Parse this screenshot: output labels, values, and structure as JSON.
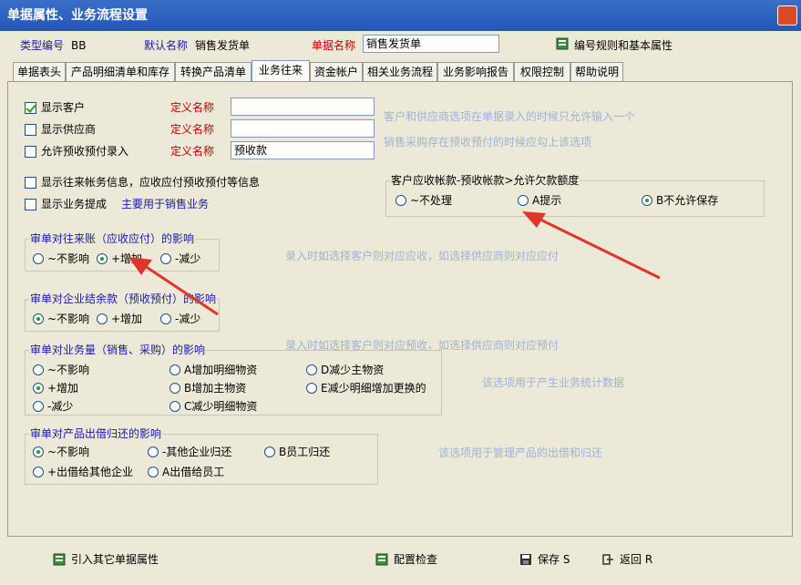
{
  "window": {
    "title": "单据属性、业务流程设置"
  },
  "header": {
    "type_code_label": "类型编号",
    "type_code_value": "BB",
    "default_name_label": "默认名称",
    "default_name_value": "销售发货单",
    "doc_name_label": "单据名称",
    "doc_name_value": "销售发货单",
    "numbering_button": "编号规则和基本属性"
  },
  "tabs": [
    "单据表头",
    "产品明细清单和库存",
    "转换产品清单",
    "业务往来",
    "资金帐户",
    "相关业务流程",
    "业务影响报告",
    "权限控制",
    "帮助说明"
  ],
  "active_tab": "业务往来",
  "options": {
    "show_customer": "显示客户",
    "show_supplier": "显示供应商",
    "allow_prepay": "允许预收预付录入",
    "define_name_label": "定义名称",
    "prepay_name_value": "预收款",
    "hint_customer": "客户和供应商选项在单据录入的时候只允许输入一个",
    "hint_prepay": "销售采购存在预收预付的时候应勾上该选项",
    "show_account_info": "显示往来帐务信息，应收应付预收预付等信息",
    "show_commission": "显示业务提成",
    "commission_note": "主要用于销售业务"
  },
  "credit_group": {
    "title": "客户应收帐款-预收帐款>允许欠款额度",
    "options": [
      "~不处理",
      "A提示",
      "B不允许保存"
    ],
    "selected": 2
  },
  "ar_group": {
    "title": "审单对往来账（应收应付）的影响",
    "options": [
      "~不影响",
      "+增加",
      "-减少"
    ],
    "selected": 1,
    "hint": "录入时如选择客户则对应应收，如选择供应商则对应应付"
  },
  "balance_group": {
    "title": "审单对企业结余款（预收预付）的影响",
    "options": [
      "~不影响",
      "+增加",
      "-减少"
    ],
    "selected": 0,
    "hint": "录入时如选择客户则对应预收，如选择供应商则对应预付"
  },
  "volume_group": {
    "title": "审单对业务量（销售、采购）的影响",
    "options": [
      "~不影响",
      "A增加明细物资",
      "D减少主物资",
      "+增加",
      "B增加主物资",
      "E减少明细增加更换的",
      "-减少",
      "C减少明细物资"
    ],
    "selected": 3,
    "hint": "该选项用于产生业务统计数据"
  },
  "lend_group": {
    "title": "审单对产品出借归还的影响",
    "options": [
      "~不影响",
      "-其他企业归还",
      "B员工归还",
      "+出借给其他企业",
      "A出借给员工"
    ],
    "selected": 0,
    "hint": "该选项用于管理产品的出借和归还"
  },
  "bottom": {
    "import_button": "引入其它单据属性",
    "check_button": "配置检查",
    "save_button": "保存 S",
    "return_button": "返回 R"
  },
  "colors": {
    "title_bar": "#2456b8",
    "label_blue": "#1a1aa8",
    "label_red": "#c00000",
    "hint": "#9db3d6",
    "arrow": "#e0352b"
  }
}
